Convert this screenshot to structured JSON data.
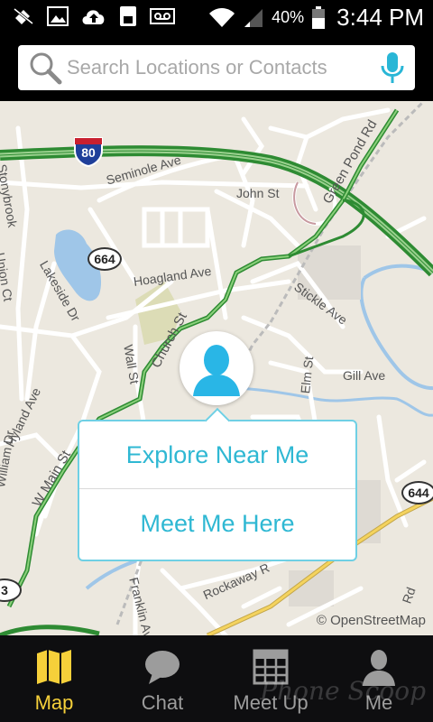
{
  "status_bar": {
    "battery_pct": "40%",
    "time": "3:44 PM",
    "icons": [
      "notifications-off-icon",
      "image-icon",
      "upload-icon",
      "sim-icon",
      "voicemail-icon",
      "wifi-icon",
      "signal-icon",
      "battery-icon"
    ]
  },
  "search": {
    "placeholder": "Search Locations or Contacts",
    "icon": "search-icon",
    "mic_icon": "mic-icon",
    "accent": "#29b6d6"
  },
  "map": {
    "labels": {
      "stonybrook": "Stonybrook",
      "seminole": "Seminole Ave",
      "john": "John St",
      "green_pond": "Green Pond Rd",
      "lakeside": "Lakeside Dr",
      "hoagland": "Hoagland Ave",
      "stickle": "Stickle Ave",
      "church": "Church St",
      "wall": "Wall St",
      "gill": "Gill Ave",
      "hyland": "Hyland Ave",
      "w_main": "W Main St",
      "william": "William Dr",
      "union": "Union Ct",
      "rockaway": "Rockaway R",
      "franklin": "Franklin Av",
      "elm": "Elm St",
      "rd_right": "Rd"
    },
    "shields": {
      "i80": "80",
      "r664a": "664",
      "r664b": "644",
      "r3": "3"
    },
    "attribution": "© OpenStreetMap"
  },
  "popup": {
    "option1": "Explore Near Me",
    "option2": "Meet Me Here",
    "accent": "#2fb8d3"
  },
  "nav": {
    "items": [
      {
        "label": "Map",
        "icon": "map-icon",
        "active": true
      },
      {
        "label": "Chat",
        "icon": "chat-icon",
        "active": false
      },
      {
        "label": "Meet Up",
        "icon": "calendar-icon",
        "active": false
      },
      {
        "label": "Me",
        "icon": "person-icon",
        "active": false
      }
    ],
    "active_color": "#f6d03a",
    "inactive_color": "#9c9c9c"
  },
  "watermark": "Phone Scoop"
}
